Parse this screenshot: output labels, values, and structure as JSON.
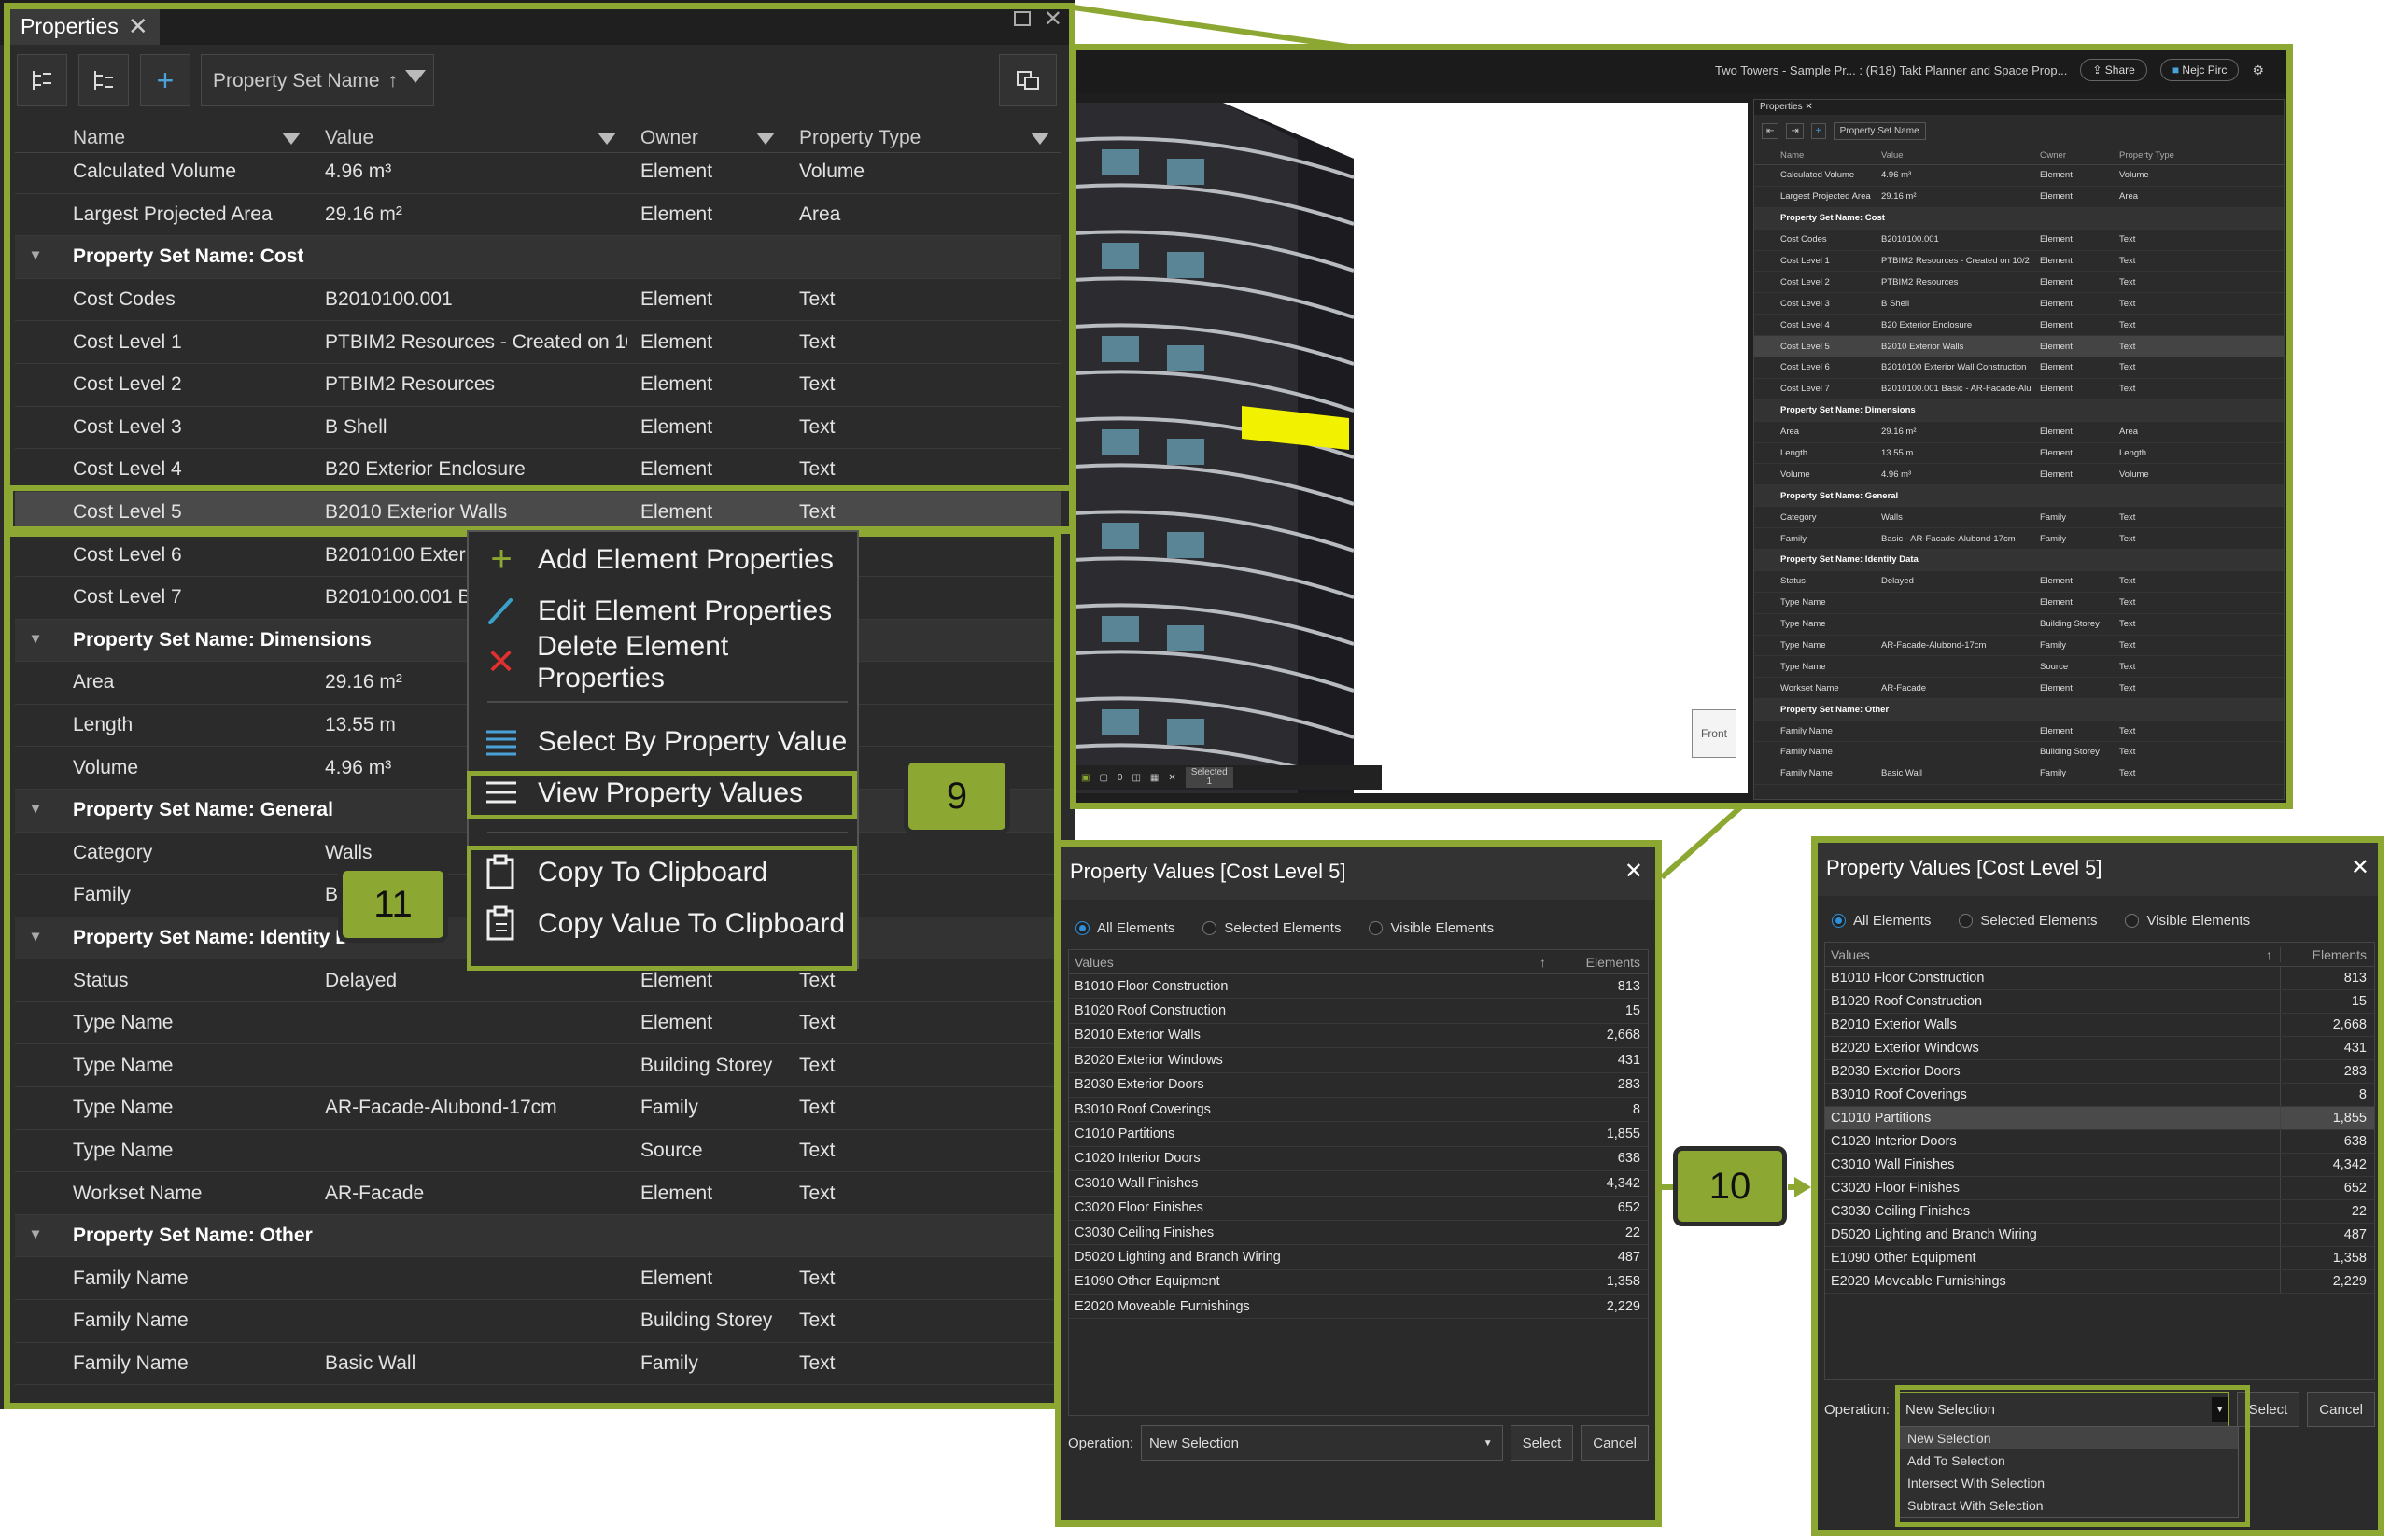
{
  "props": {
    "tab_title": "Properties",
    "filter_label": "Property Set Name",
    "columns": [
      "Name",
      "Value",
      "Owner",
      "Property Type"
    ],
    "rows": [
      {
        "type": "row",
        "name": "Calculated Volume",
        "value": "4.96 m³",
        "owner": "Element",
        "ptype": "Volume"
      },
      {
        "type": "row",
        "name": "Largest Projected Area",
        "value": "29.16 m²",
        "owner": "Element",
        "ptype": "Area"
      },
      {
        "type": "group",
        "name": "Property Set Name: Cost"
      },
      {
        "type": "row",
        "name": "Cost Codes",
        "value": "B2010100.001",
        "owner": "Element",
        "ptype": "Text"
      },
      {
        "type": "row",
        "name": "Cost Level 1",
        "value": "PTBIM2 Resources - Created on 10/2",
        "owner": "Element",
        "ptype": "Text"
      },
      {
        "type": "row",
        "name": "Cost Level 2",
        "value": "PTBIM2 Resources",
        "owner": "Element",
        "ptype": "Text"
      },
      {
        "type": "row",
        "name": "Cost Level 3",
        "value": "B Shell",
        "owner": "Element",
        "ptype": "Text"
      },
      {
        "type": "row",
        "name": "Cost Level 4",
        "value": "B20 Exterior Enclosure",
        "owner": "Element",
        "ptype": "Text"
      },
      {
        "type": "sel",
        "name": "Cost Level 5",
        "value": "B2010 Exterior Walls",
        "owner": "Element",
        "ptype": "Text"
      },
      {
        "type": "row",
        "name": "Cost Level 6",
        "value": "B2010100 Exterior",
        "owner": "",
        "ptype": ""
      },
      {
        "type": "row",
        "name": "Cost Level 7",
        "value": "B2010100.001 Basi",
        "owner": "",
        "ptype": ""
      },
      {
        "type": "group",
        "name": "Property Set Name: Dimensions"
      },
      {
        "type": "row",
        "name": "Area",
        "value": "29.16 m²",
        "owner": "",
        "ptype": ""
      },
      {
        "type": "row",
        "name": "Length",
        "value": "13.55 m",
        "owner": "",
        "ptype": ""
      },
      {
        "type": "row",
        "name": "Volume",
        "value": "4.96 m³",
        "owner": "",
        "ptype": ""
      },
      {
        "type": "group",
        "name": "Property Set Name: General"
      },
      {
        "type": "row",
        "name": "Category",
        "value": "Walls",
        "owner": "",
        "ptype": ""
      },
      {
        "type": "row",
        "name": "Family",
        "value": "Bas",
        "owner": "",
        "ptype": ""
      },
      {
        "type": "group",
        "name": "Property Set Name: Identity D"
      },
      {
        "type": "row",
        "name": "Status",
        "value": "Delayed",
        "owner": "Element",
        "ptype": "Text"
      },
      {
        "type": "row",
        "name": "Type Name",
        "value": "",
        "owner": "Element",
        "ptype": "Text"
      },
      {
        "type": "row",
        "name": "Type Name",
        "value": "",
        "owner": "Building Storey",
        "ptype": "Text"
      },
      {
        "type": "row",
        "name": "Type Name",
        "value": "AR-Facade-Alubond-17cm",
        "owner": "Family",
        "ptype": "Text"
      },
      {
        "type": "row",
        "name": "Type Name",
        "value": "",
        "owner": "Source",
        "ptype": "Text"
      },
      {
        "type": "row",
        "name": "Workset Name",
        "value": "AR-Facade",
        "owner": "Element",
        "ptype": "Text"
      },
      {
        "type": "group",
        "name": "Property Set Name: Other"
      },
      {
        "type": "row",
        "name": "Family Name",
        "value": "",
        "owner": "Element",
        "ptype": "Text"
      },
      {
        "type": "row",
        "name": "Family Name",
        "value": "",
        "owner": "Building Storey",
        "ptype": "Text"
      },
      {
        "type": "row",
        "name": "Family Name",
        "value": "Basic Wall",
        "owner": "Family",
        "ptype": "Text"
      }
    ]
  },
  "context_menu": {
    "add": "Add Element Properties",
    "edit": "Edit Element Properties",
    "delete": "Delete Element Properties",
    "select_by": "Select By Property Value",
    "view_values": "View Property Values",
    "copy": "Copy To Clipboard",
    "copy_value": "Copy Value To Clipboard"
  },
  "badges": {
    "b9": "9",
    "b10": "10",
    "b11": "11"
  },
  "app": {
    "title": "Two Towers - Sample Pr...   : (R18) Takt Planner and Space Prop...",
    "share": "Share",
    "user": "Nejc Pirc",
    "panel_tab": "Properties",
    "filter_label": "Property Set Name",
    "front_label": "Front",
    "selected_label": "Selected",
    "selected_count": "1",
    "status_count": "0"
  },
  "dialog1": {
    "title": "Property Values [Cost Level 5]",
    "radio_all": "All Elements",
    "radio_selected": "Selected Elements",
    "radio_visible": "Visible Elements",
    "col_values": "Values",
    "col_elements": "Elements",
    "operation_label": "Operation:",
    "operation_value": "New Selection",
    "select_btn": "Select",
    "cancel_btn": "Cancel"
  },
  "dialog2": {
    "title": "Property Values [Cost Level 5]",
    "operation_options": [
      "New Selection",
      "Add To Selection",
      "Intersect With Selection",
      "Subtract With Selection"
    ]
  },
  "values": [
    {
      "v": "B1010 Floor Construction",
      "n": "813"
    },
    {
      "v": "B1020 Roof Construction",
      "n": "15"
    },
    {
      "v": "B2010 Exterior Walls",
      "n": "2,668"
    },
    {
      "v": "B2020 Exterior Windows",
      "n": "431"
    },
    {
      "v": "B2030 Exterior Doors",
      "n": "283"
    },
    {
      "v": "B3010 Roof Coverings",
      "n": "8"
    },
    {
      "v": "C1010 Partitions",
      "n": "1,855"
    },
    {
      "v": "C1020 Interior Doors",
      "n": "638"
    },
    {
      "v": "C3010 Wall Finishes",
      "n": "4,342"
    },
    {
      "v": "C3020 Floor Finishes",
      "n": "652"
    },
    {
      "v": "C3030 Ceiling Finishes",
      "n": "22"
    },
    {
      "v": "D5020 Lighting and Branch Wiring",
      "n": "487"
    },
    {
      "v": "E1090 Other Equipment",
      "n": "1,358"
    },
    {
      "v": "E2020 Moveable Furnishings",
      "n": "2,229"
    }
  ],
  "mini_rows": [
    {
      "t": "r",
      "a": "Calculated Volume",
      "b": "4.96 m³",
      "c": "Element",
      "d": "Volume"
    },
    {
      "t": "r",
      "a": "Largest Projected Area",
      "b": "29.16 m²",
      "c": "Element",
      "d": "Area"
    },
    {
      "t": "g",
      "a": "Property Set Name: Cost"
    },
    {
      "t": "r",
      "a": "Cost Codes",
      "b": "B2010100.001",
      "c": "Element",
      "d": "Text"
    },
    {
      "t": "r",
      "a": "Cost Level 1",
      "b": "PTBIM2 Resources - Created on 10/2",
      "c": "Element",
      "d": "Text"
    },
    {
      "t": "r",
      "a": "Cost Level 2",
      "b": "PTBIM2 Resources",
      "c": "Element",
      "d": "Text"
    },
    {
      "t": "r",
      "a": "Cost Level 3",
      "b": "B Shell",
      "c": "Element",
      "d": "Text"
    },
    {
      "t": "r",
      "a": "Cost Level 4",
      "b": "B20 Exterior Enclosure",
      "c": "Element",
      "d": "Text"
    },
    {
      "t": "s",
      "a": "Cost Level 5",
      "b": "B2010 Exterior Walls",
      "c": "Element",
      "d": "Text"
    },
    {
      "t": "r",
      "a": "Cost Level 6",
      "b": "B2010100 Exterior Wall Construction",
      "c": "Element",
      "d": "Text"
    },
    {
      "t": "r",
      "a": "Cost Level 7",
      "b": "B2010100.001 Basic - AR-Facade-Alu",
      "c": "Element",
      "d": "Text"
    },
    {
      "t": "g",
      "a": "Property Set Name: Dimensions"
    },
    {
      "t": "r",
      "a": "Area",
      "b": "29.16 m²",
      "c": "Element",
      "d": "Area"
    },
    {
      "t": "r",
      "a": "Length",
      "b": "13.55 m",
      "c": "Element",
      "d": "Length"
    },
    {
      "t": "r",
      "a": "Volume",
      "b": "4.96 m³",
      "c": "Element",
      "d": "Volume"
    },
    {
      "t": "g",
      "a": "Property Set Name: General"
    },
    {
      "t": "r",
      "a": "Category",
      "b": "Walls",
      "c": "Family",
      "d": "Text"
    },
    {
      "t": "r",
      "a": "Family",
      "b": "Basic - AR-Facade-Alubond-17cm",
      "c": "Family",
      "d": "Text"
    },
    {
      "t": "g",
      "a": "Property Set Name: Identity Data"
    },
    {
      "t": "r",
      "a": "Status",
      "b": "Delayed",
      "c": "Element",
      "d": "Text"
    },
    {
      "t": "r",
      "a": "Type Name",
      "b": "",
      "c": "Element",
      "d": "Text"
    },
    {
      "t": "r",
      "a": "Type Name",
      "b": "",
      "c": "Building Storey",
      "d": "Text"
    },
    {
      "t": "r",
      "a": "Type Name",
      "b": "AR-Facade-Alubond-17cm",
      "c": "Family",
      "d": "Text"
    },
    {
      "t": "r",
      "a": "Type Name",
      "b": "",
      "c": "Source",
      "d": "Text"
    },
    {
      "t": "r",
      "a": "Workset Name",
      "b": "AR-Facade",
      "c": "Element",
      "d": "Text"
    },
    {
      "t": "g",
      "a": "Property Set Name: Other"
    },
    {
      "t": "r",
      "a": "Family Name",
      "b": "",
      "c": "Element",
      "d": "Text"
    },
    {
      "t": "r",
      "a": "Family Name",
      "b": "",
      "c": "Building Storey",
      "d": "Text"
    },
    {
      "t": "r",
      "a": "Family Name",
      "b": "Basic Wall",
      "c": "Family",
      "d": "Text"
    }
  ],
  "colors": {
    "accent_green": "#8ca832",
    "selection_yellow": "#f2f200",
    "radio_blue": "#2f8fd8"
  }
}
